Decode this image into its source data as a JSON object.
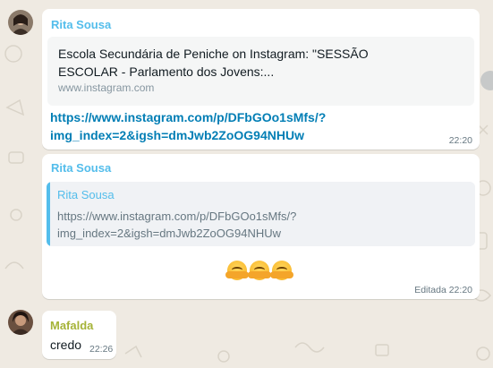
{
  "colors": {
    "background": "#efeae2",
    "sender_rita": "#53bdeb",
    "sender_mafalda": "#a5b337",
    "link": "#027eb5",
    "meta": "#667781"
  },
  "messages": [
    {
      "sender": "Rita Sousa",
      "preview": {
        "title": "Escola Secundária de Peniche on Instagram: \"SESSÃO ESCOLAR - Parlamento dos Jovens:...",
        "domain": "www.instagram.com"
      },
      "link_line1": "https://www.instagram.com/p/DFbGOo1sMfs/?",
      "link_line2": "img_index=2&igsh=dmJwb2ZoOG94NHUw",
      "time": "22:20"
    },
    {
      "sender": "Rita Sousa",
      "quote": {
        "author": "Rita Sousa",
        "line1": "https://www.instagram.com/p/DFbGOo1sMfs/?",
        "line2": "img_index=2&igsh=dmJwb2ZoOG94NHUw"
      },
      "emoji_name": "hugging-face-icon",
      "time": "Editada 22:20"
    },
    {
      "sender": "Mafalda",
      "text": "credo",
      "time": "22:26"
    }
  ]
}
